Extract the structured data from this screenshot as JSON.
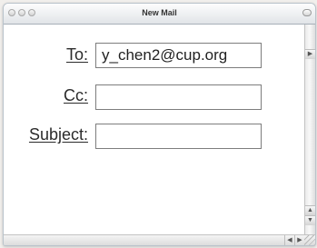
{
  "window": {
    "title": "New Mail"
  },
  "form": {
    "to_label": "To:",
    "to_value": "y_chen2@cup.org",
    "cc_label": "Cc:",
    "cc_value": "",
    "subject_label": "Subject:",
    "subject_value": ""
  },
  "icons": {
    "close": "close-icon",
    "minimize": "minimize-icon",
    "zoom": "zoom-icon",
    "toolbar_toggle": "toolbar-toggle-icon",
    "scroll_up": "▲",
    "scroll_down": "▼",
    "scroll_left": "◀",
    "scroll_right": "▶",
    "scroll_right_top": "▶"
  }
}
